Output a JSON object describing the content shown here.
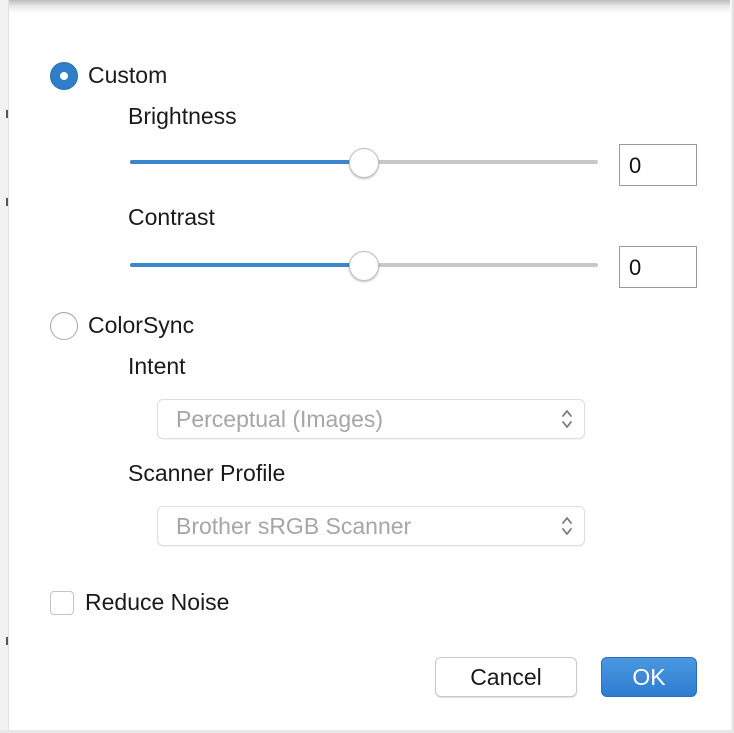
{
  "color_mode": {
    "selected": "custom",
    "custom": {
      "label": "Custom",
      "brightness": {
        "label": "Brightness",
        "value": "0",
        "slider_fraction": 0.5
      },
      "contrast": {
        "label": "Contrast",
        "value": "0",
        "slider_fraction": 0.5
      }
    },
    "colorsync": {
      "label": "ColorSync",
      "intent": {
        "label": "Intent",
        "selected": "Perceptual (Images)"
      },
      "scanner_profile": {
        "label": "Scanner Profile",
        "selected": "Brother sRGB Scanner"
      }
    }
  },
  "reduce_noise": {
    "label": "Reduce Noise",
    "checked": false
  },
  "buttons": {
    "cancel": "Cancel",
    "ok": "OK"
  },
  "colors": {
    "accent": "#2f7ec9",
    "slider_fill": "#3a86cf",
    "disabled_text": "#a6a6a6"
  },
  "icons": {
    "popup_arrows": "chevron-up-down-icon"
  }
}
